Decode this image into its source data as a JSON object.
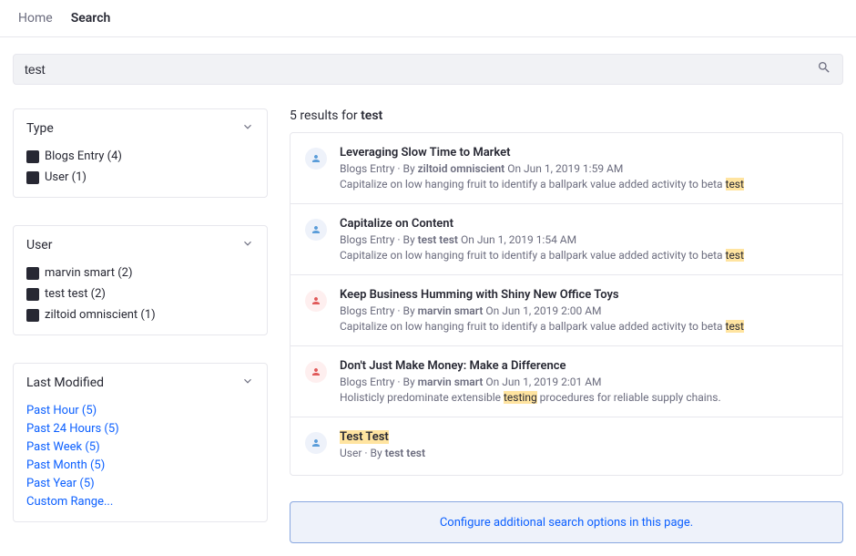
{
  "nav": {
    "home": "Home",
    "search": "Search"
  },
  "search": {
    "value": "test"
  },
  "facets": {
    "type": {
      "title": "Type",
      "items": [
        {
          "label": "Blogs Entry (4)"
        },
        {
          "label": "User (1)"
        }
      ]
    },
    "user": {
      "title": "User",
      "items": [
        {
          "label": "marvin smart (2)"
        },
        {
          "label": "test test (2)"
        },
        {
          "label": "ziltoid omniscient (1)"
        }
      ]
    },
    "modified": {
      "title": "Last Modified",
      "items": [
        {
          "label": "Past Hour (5)"
        },
        {
          "label": "Past 24 Hours (5)"
        },
        {
          "label": "Past Week (5)"
        },
        {
          "label": "Past Month (5)"
        },
        {
          "label": "Past Year (5)"
        },
        {
          "label": "Custom Range..."
        }
      ]
    }
  },
  "results": {
    "count_prefix": "5 results for ",
    "count_term": "test",
    "items": [
      {
        "color": "blue",
        "title": "Leveraging Slow Time to Market",
        "kind": "Blogs Entry",
        "by": "ziltoid omniscient",
        "date": "On Jun 1, 2019 1:59 AM",
        "snippet_pre": "Capitalize on low hanging fruit to identify a ballpark value added activity to beta ",
        "snippet_hl": "test",
        "snippet_post": ""
      },
      {
        "color": "blue",
        "title": "Capitalize on Content",
        "kind": "Blogs Entry",
        "by": "test test",
        "date": "On Jun 1, 2019 1:54 AM",
        "snippet_pre": "Capitalize on low hanging fruit to identify a ballpark value added activity to beta ",
        "snippet_hl": "test",
        "snippet_post": ""
      },
      {
        "color": "red",
        "title": "Keep Business Humming with Shiny New Office Toys",
        "kind": "Blogs Entry",
        "by": "marvin smart",
        "date": "On Jun 1, 2019 2:00 AM",
        "snippet_pre": "Capitalize on low hanging fruit to identify a ballpark value added activity to beta ",
        "snippet_hl": "test",
        "snippet_post": ""
      },
      {
        "color": "red",
        "title": "Don't Just Make Money: Make a Difference",
        "kind": "Blogs Entry",
        "by": "marvin smart",
        "date": "On Jun 1, 2019 2:01 AM",
        "snippet_pre": "Holisticly predominate extensible ",
        "snippet_hl": "testing",
        "snippet_post": " procedures for reliable supply chains."
      },
      {
        "color": "blue",
        "title_hl": "Test Test",
        "kind": "User",
        "by": "test test",
        "date": "",
        "snippet_pre": "",
        "snippet_hl": "",
        "snippet_post": ""
      }
    ]
  },
  "banner": {
    "text": "Configure additional search options in this page."
  }
}
